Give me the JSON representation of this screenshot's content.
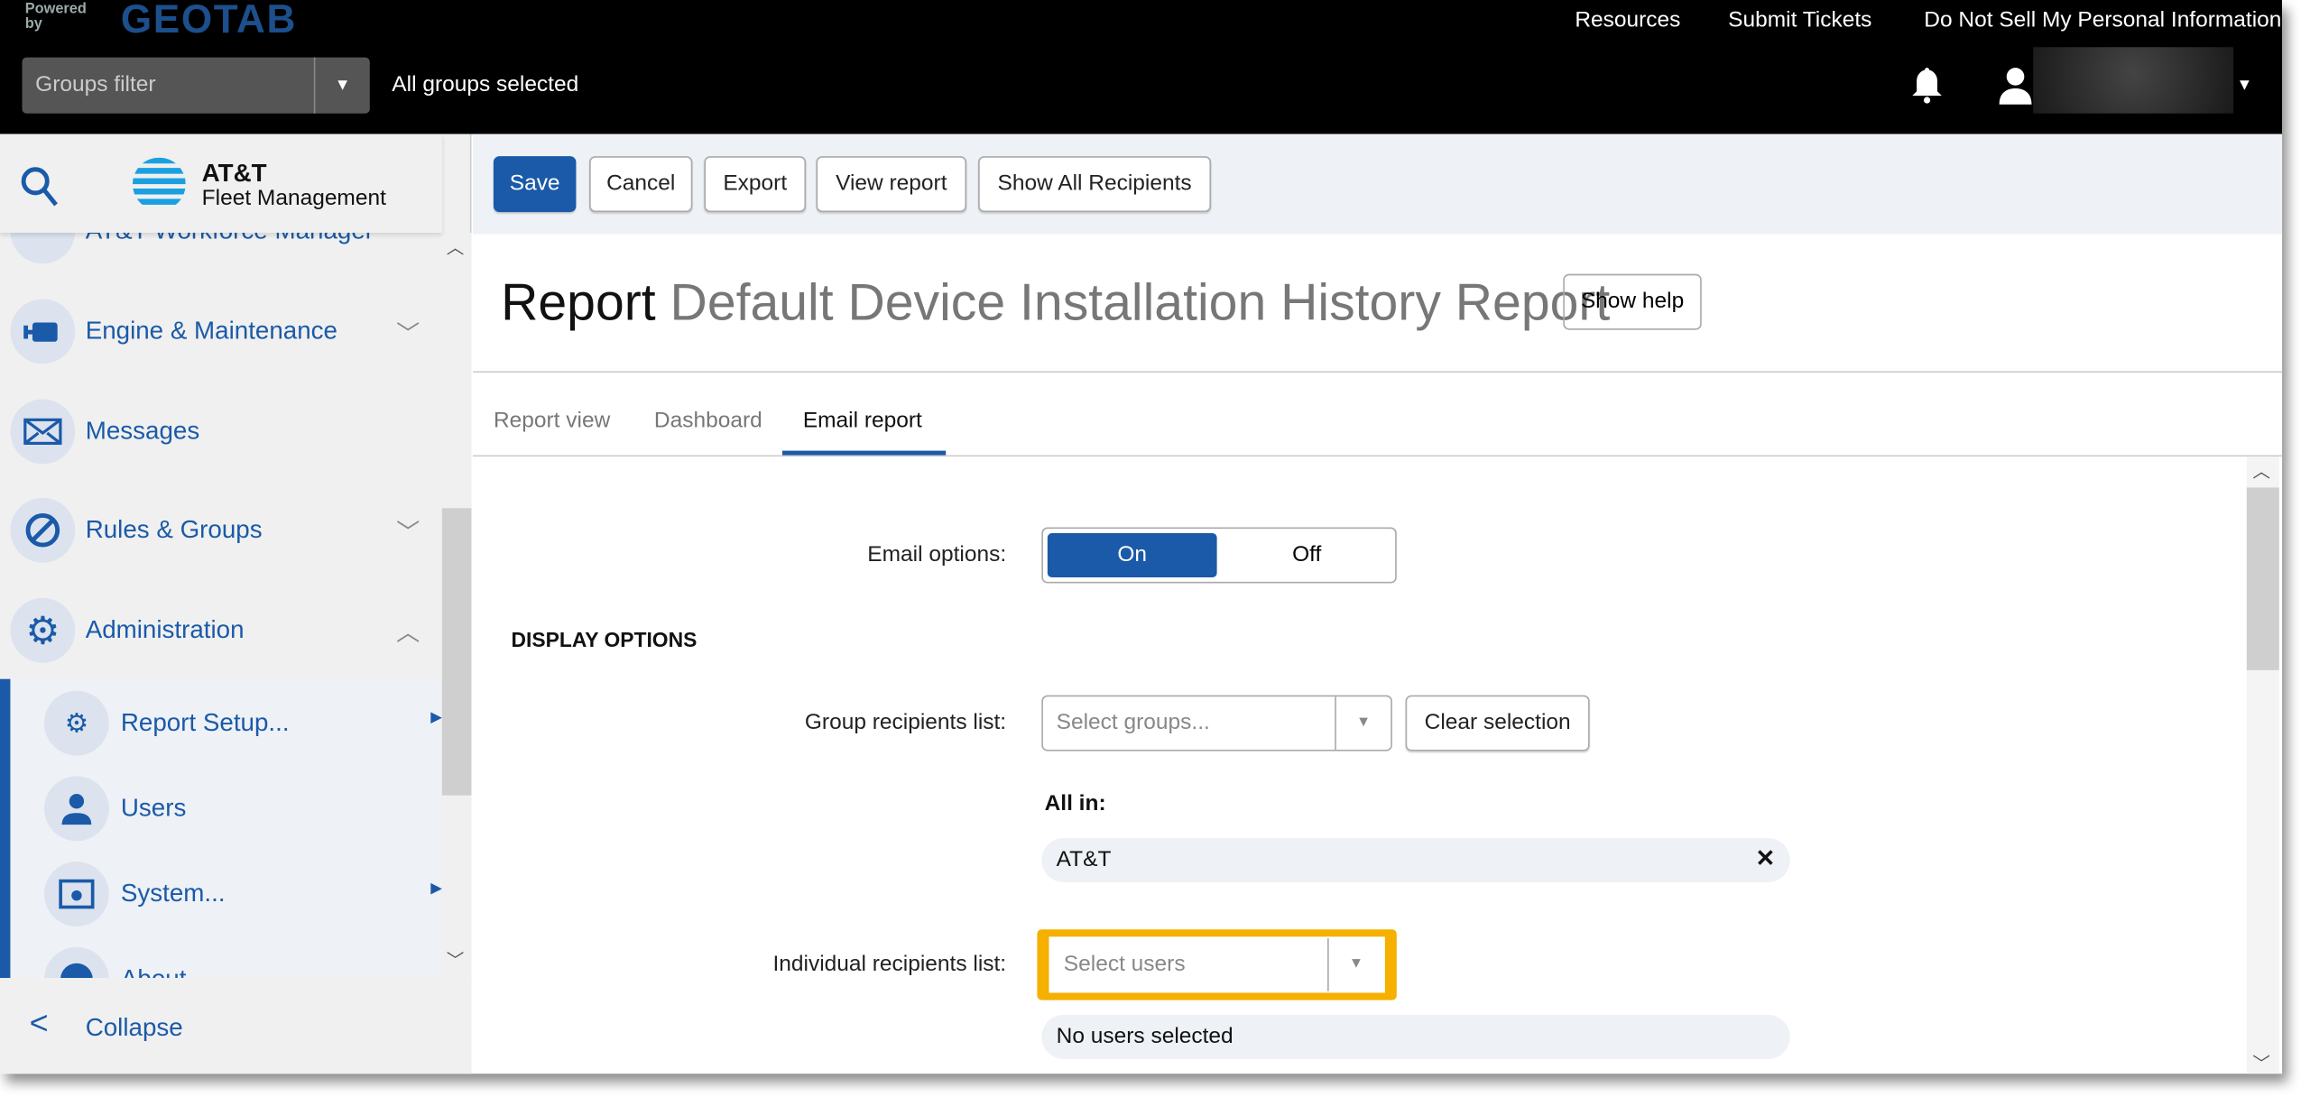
{
  "topbar": {
    "powered_by": "Powered by",
    "brand": "GEOTAB",
    "links": [
      "Resources",
      "Submit Tickets",
      "Do Not Sell My Personal Information"
    ],
    "groups_filter_placeholder": "Groups filter",
    "groups_status": "All groups selected"
  },
  "sidebar": {
    "brand_line1": "AT&T",
    "brand_line2": "Fleet Management",
    "items": [
      {
        "label": "AT&T Workforce Manager"
      },
      {
        "label": "Engine & Maintenance"
      },
      {
        "label": "Messages"
      },
      {
        "label": "Rules & Groups"
      },
      {
        "label": "Administration"
      }
    ],
    "sub_items": [
      {
        "label": "Report Setup..."
      },
      {
        "label": "Users"
      },
      {
        "label": "System..."
      },
      {
        "label": "About"
      }
    ],
    "collapse": "Collapse"
  },
  "toolbar": {
    "save": "Save",
    "cancel": "Cancel",
    "export": "Export",
    "view_report": "View report",
    "show_all": "Show All Recipients"
  },
  "page": {
    "title_prefix": "Report",
    "title_name": "Default Device Installation History Report",
    "show_help": "Show help"
  },
  "tabs": [
    {
      "label": "Report view"
    },
    {
      "label": "Dashboard"
    },
    {
      "label": "Email report",
      "active": true
    }
  ],
  "form": {
    "email_options_label": "Email options:",
    "on": "On",
    "off": "Off",
    "email_options_value": "On",
    "display_options": "DISPLAY OPTIONS",
    "group_label": "Group recipients list:",
    "group_placeholder": "Select groups...",
    "clear_selection": "Clear selection",
    "all_in": "All in:",
    "group_chip": "AT&T",
    "individual_label": "Individual recipients list:",
    "individual_placeholder": "Select users",
    "no_users": "No users selected"
  },
  "colors": {
    "accent": "#1a5aa8",
    "highlight": "#f5b000"
  }
}
